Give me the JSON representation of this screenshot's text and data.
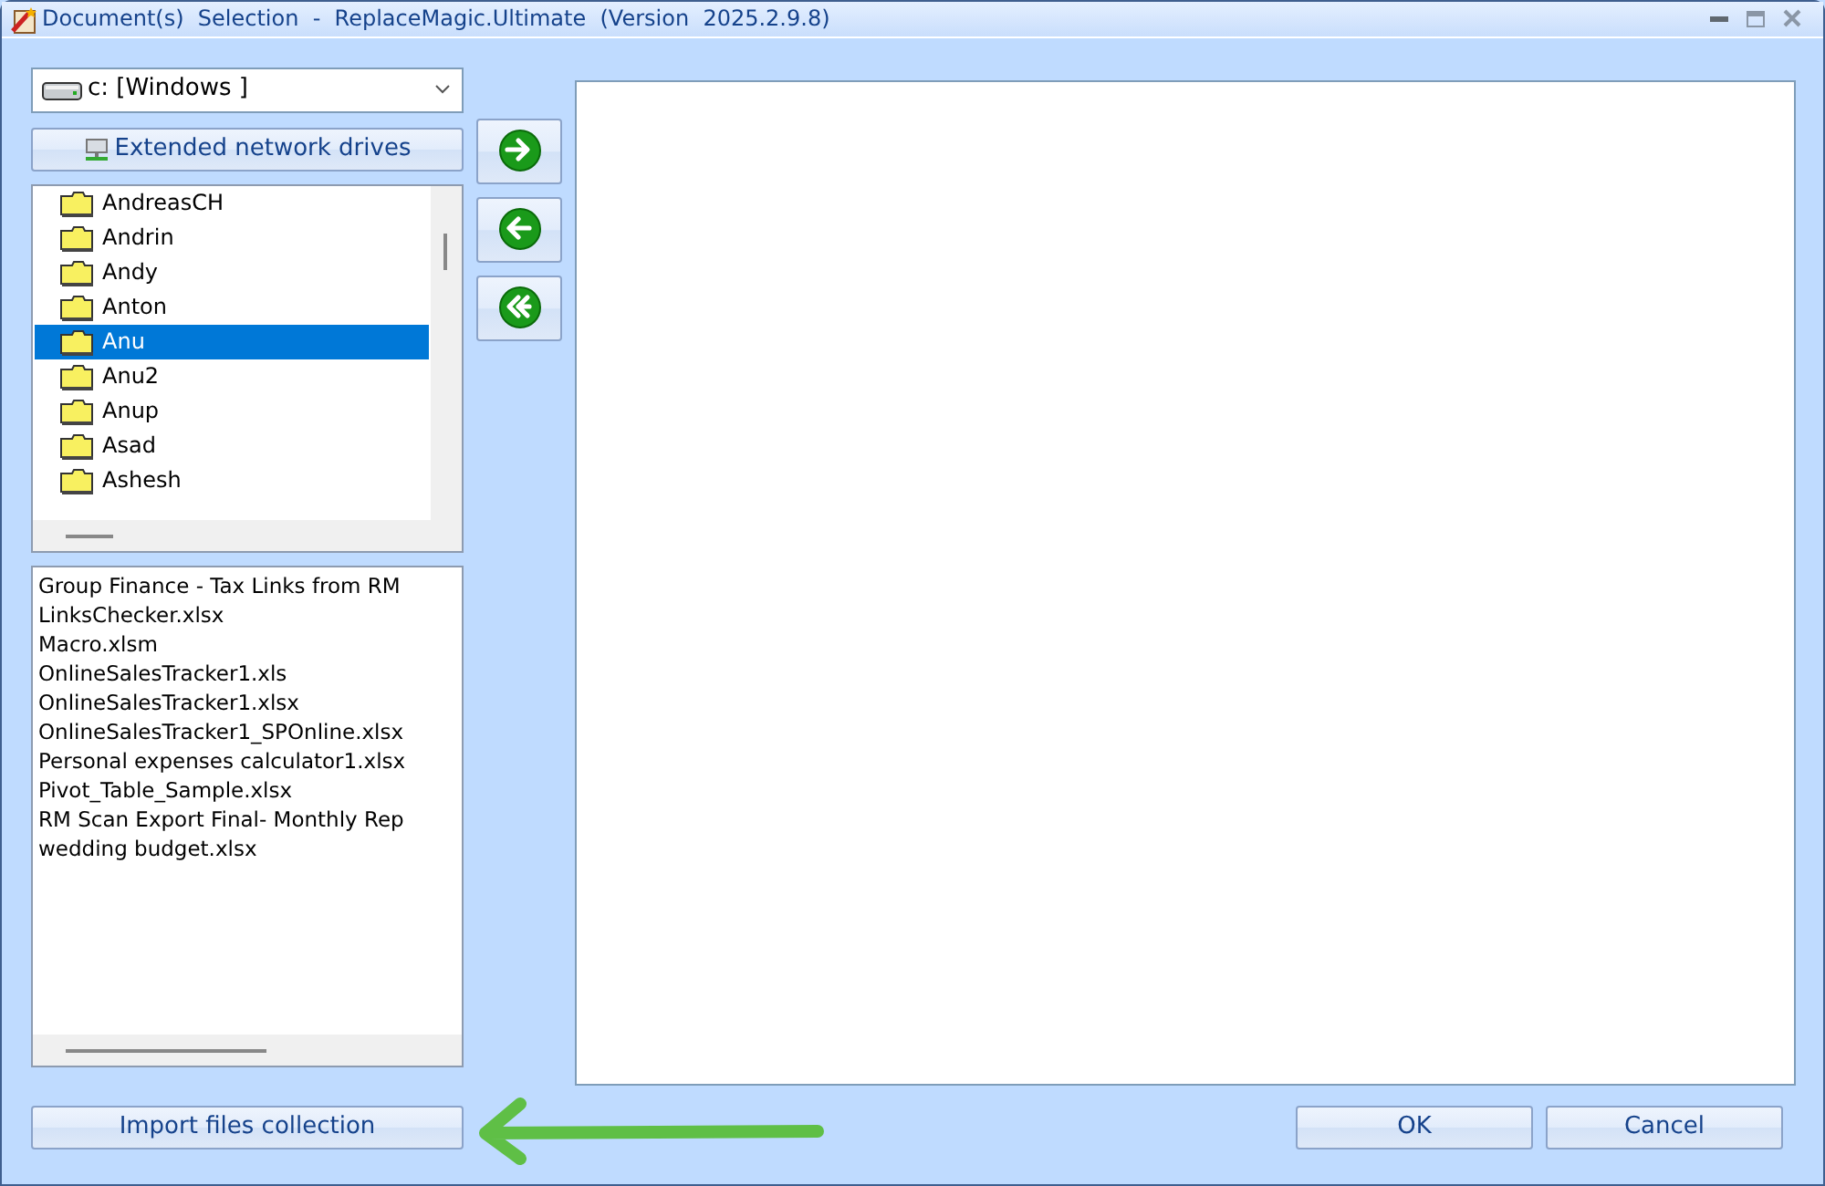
{
  "window": {
    "title": "Document(s)  Selection  -  ReplaceMagic.Ultimate  (Version  2025.2.9.8)"
  },
  "drive_select": {
    "value": "c: [Windows ]"
  },
  "network_button": {
    "label": "Extended network drives"
  },
  "folders": [
    {
      "name": "AndreasCH",
      "selected": false
    },
    {
      "name": "Andrin",
      "selected": false
    },
    {
      "name": "Andy",
      "selected": false
    },
    {
      "name": "Anton",
      "selected": false
    },
    {
      "name": "Anu",
      "selected": true
    },
    {
      "name": "Anu2",
      "selected": false
    },
    {
      "name": "Anup",
      "selected": false
    },
    {
      "name": "Asad",
      "selected": false
    },
    {
      "name": "Ashesh",
      "selected": false
    }
  ],
  "files": [
    "Group Finance - Tax Links from RM",
    "LinksChecker.xlsx",
    "Macro.xlsm",
    "OnlineSalesTracker1.xls",
    "OnlineSalesTracker1.xlsx",
    "OnlineSalesTracker1_SPOnline.xlsx",
    "Personal expenses calculator1.xlsx",
    "Pivot_Table_Sample.xlsx",
    "RM Scan Export Final- Monthly Rep",
    "wedding budget.xlsx"
  ],
  "transfer_buttons": [
    {
      "kind": "add"
    },
    {
      "kind": "remove"
    },
    {
      "kind": "remove_all"
    }
  ],
  "import_button": {
    "label": "Import files collection"
  },
  "buttons": [
    "OK",
    "Cancel"
  ]
}
